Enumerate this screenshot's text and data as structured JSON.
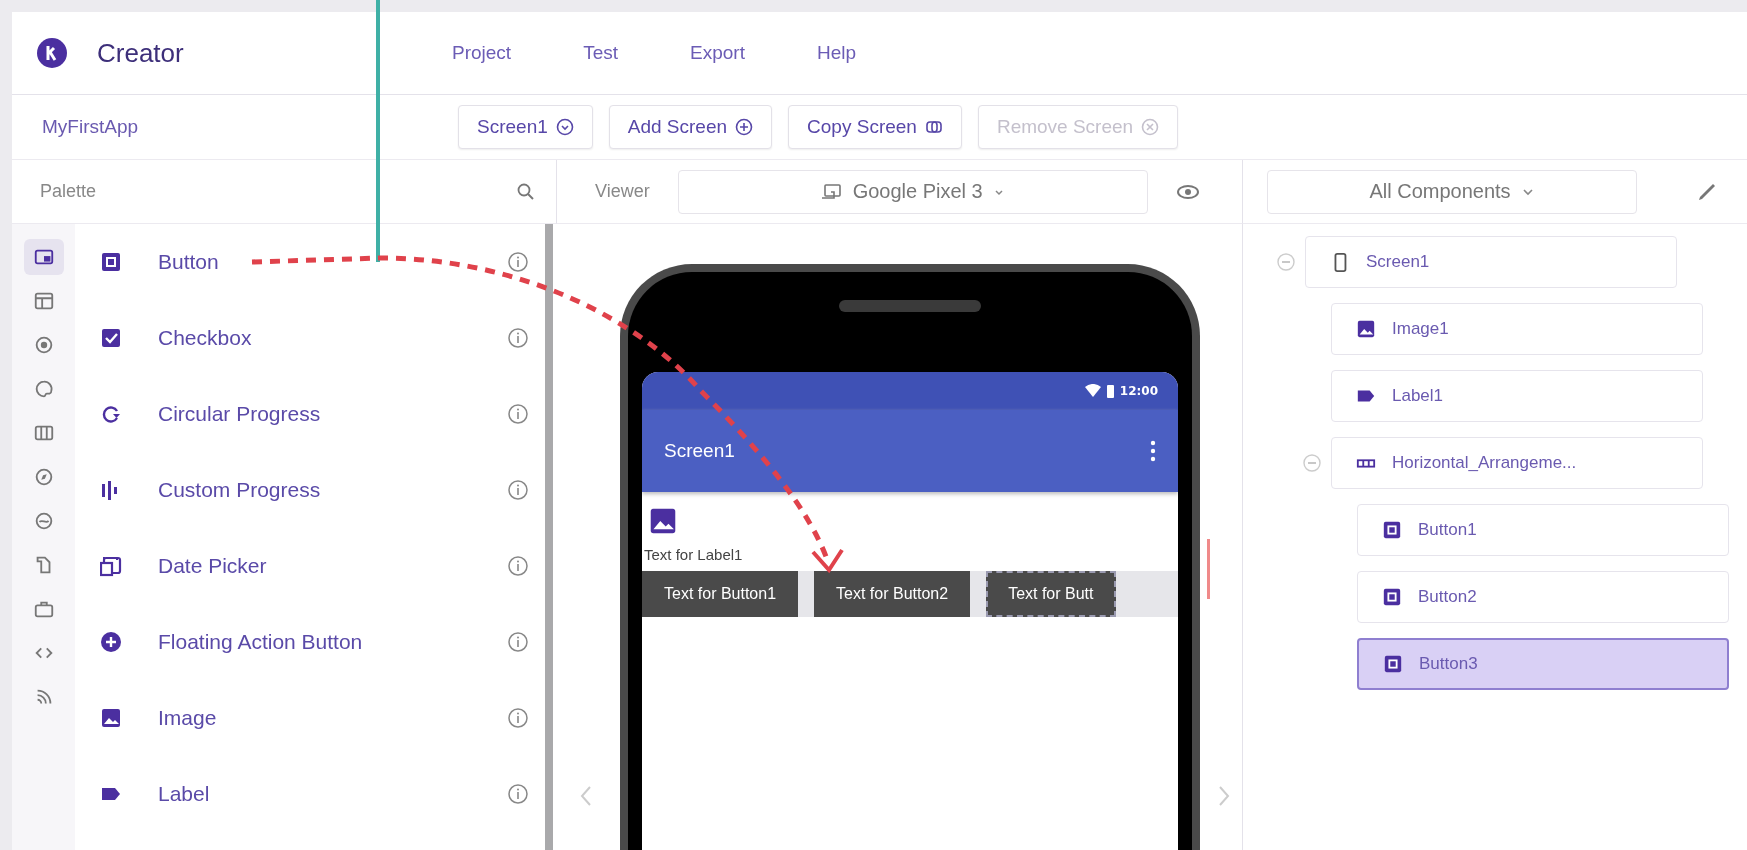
{
  "app": {
    "title": "Creator"
  },
  "menu": [
    "Project",
    "Test",
    "Export",
    "Help"
  ],
  "project_name": "MyFirstApp",
  "toolbar": [
    {
      "kind": "dropdown",
      "label": "Screen1",
      "disabled": false
    },
    {
      "kind": "add",
      "label": "Add Screen",
      "disabled": false
    },
    {
      "kind": "copy",
      "label": "Copy Screen",
      "disabled": false
    },
    {
      "kind": "remove",
      "label": "Remove Screen",
      "disabled": true
    }
  ],
  "palette": {
    "title": "Palette",
    "categories": [
      {
        "selected": true
      },
      {
        "selected": false
      },
      {
        "selected": false
      },
      {
        "selected": false
      },
      {
        "selected": false
      },
      {
        "selected": false
      },
      {
        "selected": false
      },
      {
        "selected": false
      },
      {
        "selected": false
      },
      {
        "selected": false
      },
      {
        "selected": false
      }
    ],
    "items": [
      {
        "kind": "button",
        "name": "Button"
      },
      {
        "kind": "checkbox",
        "name": "Checkbox"
      },
      {
        "kind": "circular_progress",
        "name": "Circular Progress"
      },
      {
        "kind": "custom_progress",
        "name": "Custom Progress"
      },
      {
        "kind": "date_picker",
        "name": "Date Picker"
      },
      {
        "kind": "fab",
        "name": "Floating Action Button"
      },
      {
        "kind": "image",
        "name": "Image"
      },
      {
        "kind": "label",
        "name": "Label"
      }
    ]
  },
  "viewer": {
    "title": "Viewer",
    "device": "Google Pixel 3",
    "phone": {
      "time": "12:00",
      "screen_title": "Screen1",
      "label": "Text for Label1",
      "buttons": [
        {
          "text": "Text for Button1",
          "selected": false
        },
        {
          "text": "Text for Button2",
          "selected": false
        },
        {
          "text": "Text for Butt",
          "selected": true
        }
      ]
    }
  },
  "components": {
    "filter": "All Components",
    "tree": [
      {
        "kind": "screen",
        "name": "Screen1",
        "selected": false,
        "expanded": true,
        "children": [
          {
            "kind": "image",
            "name": "Image1",
            "selected": false
          },
          {
            "kind": "label",
            "name": "Label1",
            "selected": false
          },
          {
            "kind": "arrangement",
            "name": "Horizontal_Arrangeme...",
            "selected": false,
            "expanded": true,
            "children": [
              {
                "kind": "button",
                "name": "Button1",
                "selected": false
              },
              {
                "kind": "button",
                "name": "Button2",
                "selected": false
              },
              {
                "kind": "button",
                "name": "Button3",
                "selected": true
              }
            ]
          }
        ]
      }
    ]
  }
}
